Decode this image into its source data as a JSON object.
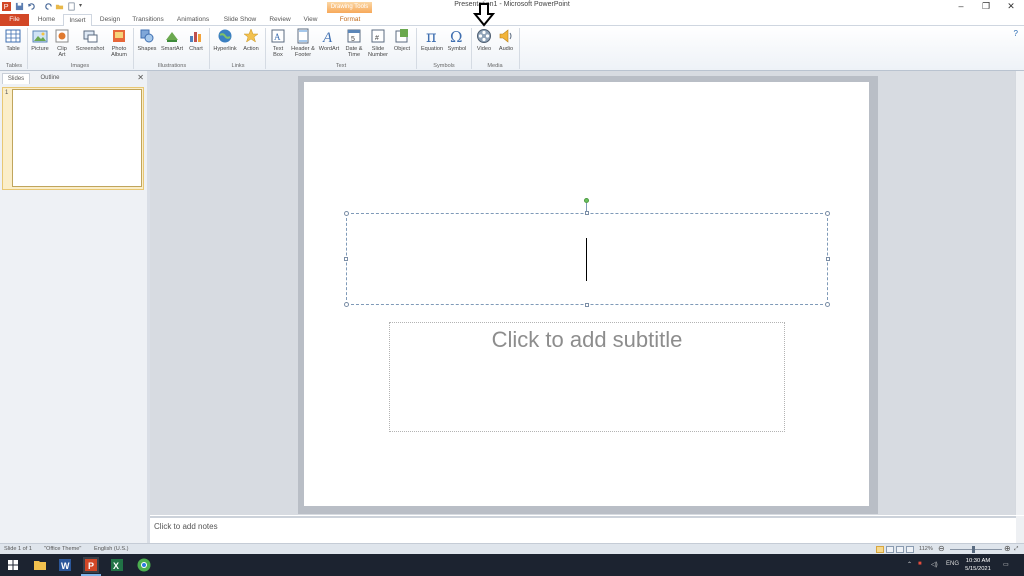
{
  "window": {
    "title": "Presentation1 - Microsoft PowerPoint",
    "contextual_tab_group": "Drawing Tools",
    "minimize_label": "–",
    "restore_label": "❐",
    "close_label": "✕"
  },
  "tabs": [
    "File",
    "Home",
    "Insert",
    "Design",
    "Transitions",
    "Animations",
    "Slide Show",
    "Review",
    "View",
    "Format"
  ],
  "active_tab": "Insert",
  "ribbon": {
    "groups": [
      {
        "label": "Tables",
        "buttons": [
          "Table"
        ]
      },
      {
        "label": "Images",
        "buttons": [
          "Picture",
          "Clip Art",
          "Screenshot",
          "Photo Album"
        ]
      },
      {
        "label": "Illustrations",
        "buttons": [
          "Shapes",
          "SmartArt",
          "Chart"
        ]
      },
      {
        "label": "Links",
        "buttons": [
          "Hyperlink",
          "Action"
        ]
      },
      {
        "label": "Text",
        "buttons": [
          "Text Box",
          "Header & Footer",
          "WordArt",
          "Date & Time",
          "Slide Number",
          "Object"
        ]
      },
      {
        "label": "Symbols",
        "buttons": [
          "Equation",
          "Symbol"
        ]
      },
      {
        "label": "Media",
        "buttons": [
          "Video",
          "Audio"
        ]
      }
    ],
    "help_icon": "?"
  },
  "left_pane": {
    "tabs": [
      "Slides",
      "Outline"
    ],
    "active_tab": "Slides",
    "close_label": "✕",
    "thumbnails": [
      {
        "number": "1"
      }
    ]
  },
  "slide": {
    "subtitle_placeholder": "Click to add subtitle"
  },
  "notes": {
    "placeholder": "Click to add notes"
  },
  "status_bar": {
    "slide_info": "Slide 1 of 1",
    "theme": "\"Office Theme\"",
    "language": "English (U.S.)",
    "zoom": "112%",
    "zoom_fraction": 0.42
  },
  "taskbar": {
    "tray_lang": "ENG",
    "time": "10:30 AM",
    "date": "5/15/2021"
  },
  "colors": {
    "file_tab": "#d24726",
    "contextual_tab": "#f7a95a",
    "taskbar": "#1c2330"
  }
}
